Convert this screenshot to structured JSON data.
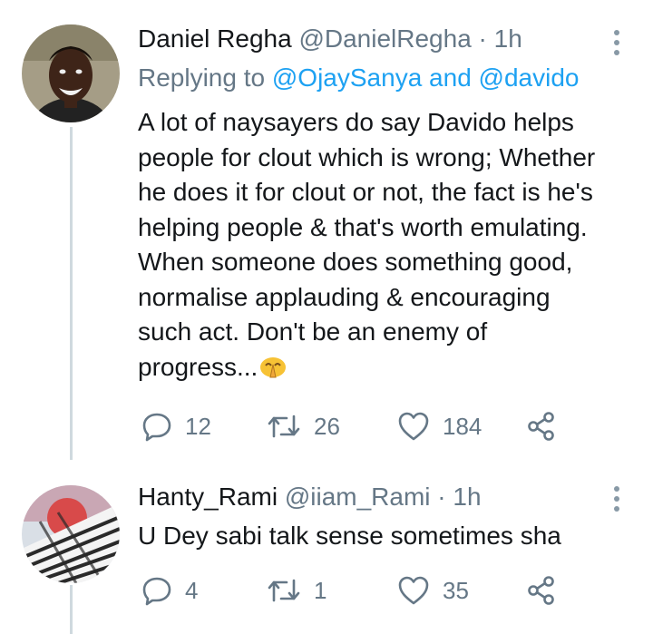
{
  "tweets": [
    {
      "display_name": "Daniel Regha",
      "handle": "@DanielRegha",
      "separator": "·",
      "time": "1h",
      "replying_prefix": "Replying to",
      "mention_1": "@OjaySanya",
      "mention_join": "and",
      "mention_2": "@davido",
      "body_lines": [
        "A lot of naysayers do say Davido helps",
        "people for clout which is wrong; Whether",
        "he does it for clout or not, the fact is he's",
        "helping people & that's worth emulating.",
        "When someone does something good,",
        "normalise applauding & encouraging",
        "such act. Don't be an enemy of",
        "progress..."
      ],
      "emoji": "folded-hands-emoji",
      "replies": "12",
      "retweets": "26",
      "likes": "184"
    },
    {
      "display_name": "Hanty_Rami",
      "handle": "@iiam_Rami",
      "separator": "·",
      "time": "1h",
      "body_lines": [
        "U Dey sabi talk sense sometimes sha"
      ],
      "replies": "4",
      "retweets": "1",
      "likes": "35"
    }
  ],
  "icons": [
    "reply-icon",
    "retweet-icon",
    "like-icon",
    "share-icon",
    "more-icon"
  ],
  "colors": {
    "link": "#1da1f2",
    "muted": "#657786",
    "text": "#14171a",
    "thread": "#cfd9de"
  }
}
